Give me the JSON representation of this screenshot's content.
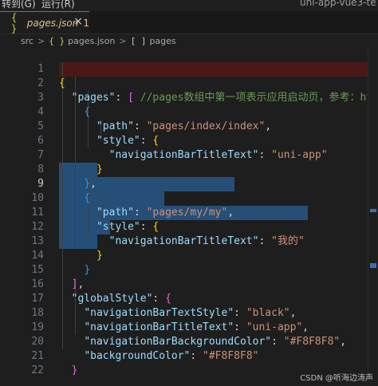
{
  "menubar": {
    "items": [
      "转到(G)",
      "运行(R)"
    ],
    "window_title": "uni-app-vue3-te"
  },
  "tab": {
    "icon_text": "{ }",
    "label": "pages.json",
    "modified_marker": "1",
    "close_glyph": "×"
  },
  "breadcrumb": {
    "src": "src",
    "sep": ">",
    "json_icon": "{ }",
    "file": "pages.json",
    "array_icon": "[ ]",
    "node": "pages"
  },
  "editor": {
    "line_numbers": [
      "1",
      "2",
      "3",
      "4",
      "5",
      "6",
      "7",
      "8",
      "9",
      "10",
      "11",
      "12",
      "13",
      "14",
      "15",
      "16",
      "17",
      "18",
      "19",
      "20",
      "21",
      "22"
    ],
    "active_line": "9",
    "lines": {
      "l1": {
        "open": "{"
      },
      "l2": {
        "key": "\"pages\"",
        "colon": ": ",
        "bracket": "[",
        "comment": " //pages数组中第一项表示应用启动页，参考：ht"
      },
      "l3": {
        "open": "{"
      },
      "l4": {
        "key": "\"path\"",
        "colon": ": ",
        "value": "\"pages/index/index\"",
        "comma": ","
      },
      "l5": {
        "key": "\"style\"",
        "colon": ": ",
        "open": "{"
      },
      "l6": {
        "key": "\"navigationBarTitleText\"",
        "colon": ": ",
        "value": "\"uni-app\""
      },
      "l7": {
        "close": "}"
      },
      "l8": {
        "close": "}",
        "comma": ","
      },
      "l9": {
        "open": "{"
      },
      "l10": {
        "key": "\"path\"",
        "colon": ": ",
        "value": "\"pages/my/my\"",
        "comma": ","
      },
      "l11": {
        "key": "\"style\"",
        "colon": ": ",
        "open": "{"
      },
      "l12": {
        "key": "\"navigationBarTitleText\"",
        "colon": ": ",
        "value": "\"我的\""
      },
      "l13": {
        "close": "}"
      },
      "l14": {
        "close": "}"
      },
      "l15": {
        "close": "]",
        "comma": ","
      },
      "l16": {
        "key": "\"globalStyle\"",
        "colon": ": ",
        "open": "{"
      },
      "l17": {
        "key": "\"navigationBarTextStyle\"",
        "colon": ": ",
        "value": "\"black\"",
        "comma": ","
      },
      "l18": {
        "key": "\"navigationBarTitleText\"",
        "colon": ": ",
        "value": "\"uni-app\"",
        "comma": ","
      },
      "l19": {
        "key": "\"navigationBarBackgroundColor\"",
        "colon": ": ",
        "value": "\"#F8F8F8\"",
        "comma": ","
      },
      "l20": {
        "key": "\"backgroundColor\"",
        "colon": ": ",
        "value": "\"#F8F8F8\""
      },
      "l21": {
        "close": "}"
      },
      "l22": {
        "close": "}"
      }
    }
  },
  "watermark": "CSDN @听海边涛声",
  "colors": {
    "background": "#1e1e1e",
    "selection": "#264f78",
    "json_key": "#9cdcfe",
    "json_string": "#ce9178",
    "comment": "#6a9955",
    "bracket_level1": "#ffd700",
    "bracket_level2": "#da70d6",
    "bracket_level3": "#179fff"
  }
}
